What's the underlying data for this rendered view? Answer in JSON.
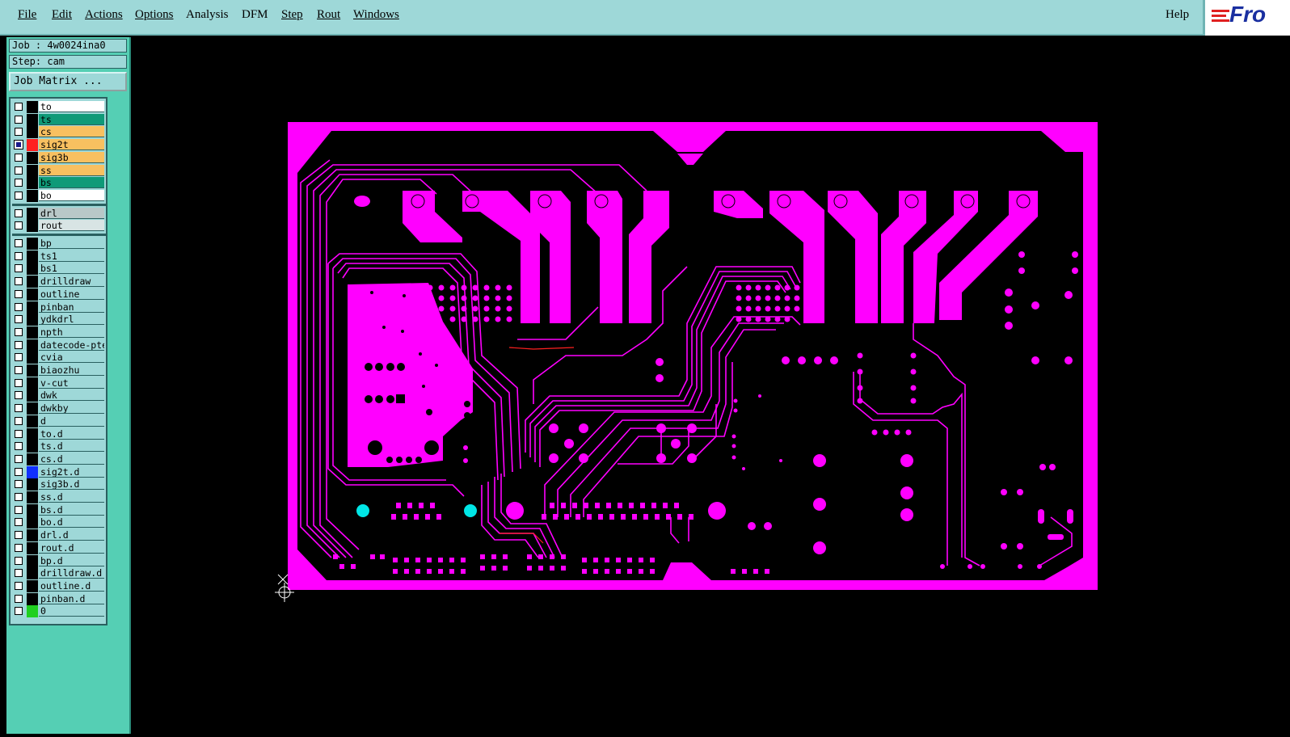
{
  "menu": [
    "File",
    "Edit",
    "Actions",
    "Options",
    "Analysis",
    "DFM",
    "Step",
    "Rout",
    "Windows"
  ],
  "help": "Help",
  "logo_text": "Fro",
  "job": "Job : 4w0024ina0",
  "step": "Step: cam",
  "job_matrix": "Job Matrix ...",
  "layers": [
    {
      "name": "to",
      "bg": "#ffffff"
    },
    {
      "name": "ts",
      "bg": "#0f9a78"
    },
    {
      "name": "cs",
      "bg": "#f8c060"
    },
    {
      "name": "sig2t",
      "bg": "#f8c060",
      "swatch": "#ff2020",
      "checked": true
    },
    {
      "name": "sig3b",
      "bg": "#f8c060"
    },
    {
      "name": "ss",
      "bg": "#f8c060"
    },
    {
      "name": "bs",
      "bg": "#0f9a78"
    },
    {
      "name": "bo",
      "bg": "#ffffff"
    },
    {
      "name": "drl",
      "bg": "#b8c8c8"
    },
    {
      "name": "rout",
      "bg": "#d8e4e4"
    },
    {
      "name": "bp"
    },
    {
      "name": "ts1"
    },
    {
      "name": "bs1"
    },
    {
      "name": "drilldraw"
    },
    {
      "name": "outline"
    },
    {
      "name": "pinban"
    },
    {
      "name": "ydkdrl"
    },
    {
      "name": "npth"
    },
    {
      "name": "datecode-pte"
    },
    {
      "name": "cvia"
    },
    {
      "name": "biaozhu"
    },
    {
      "name": "v-cut"
    },
    {
      "name": "dwk"
    },
    {
      "name": "dwkby"
    },
    {
      "name": "d"
    },
    {
      "name": "to.d"
    },
    {
      "name": "ts.d"
    },
    {
      "name": "cs.d"
    },
    {
      "name": "sig2t.d",
      "swatch": "#1030ff"
    },
    {
      "name": "sig3b.d"
    },
    {
      "name": "ss.d"
    },
    {
      "name": "bs.d"
    },
    {
      "name": "bo.d"
    },
    {
      "name": "drl.d"
    },
    {
      "name": "rout.d"
    },
    {
      "name": "bp.d"
    },
    {
      "name": "drilldraw.d"
    },
    {
      "name": "outline.d"
    },
    {
      "name": "pinban.d"
    },
    {
      "name": "0",
      "swatch": "#20d020"
    }
  ],
  "colors": {
    "copper": "#ff00ff",
    "drill": "#00e6e6",
    "panel": "#55cfb4",
    "menubar": "#9ed8d8"
  }
}
